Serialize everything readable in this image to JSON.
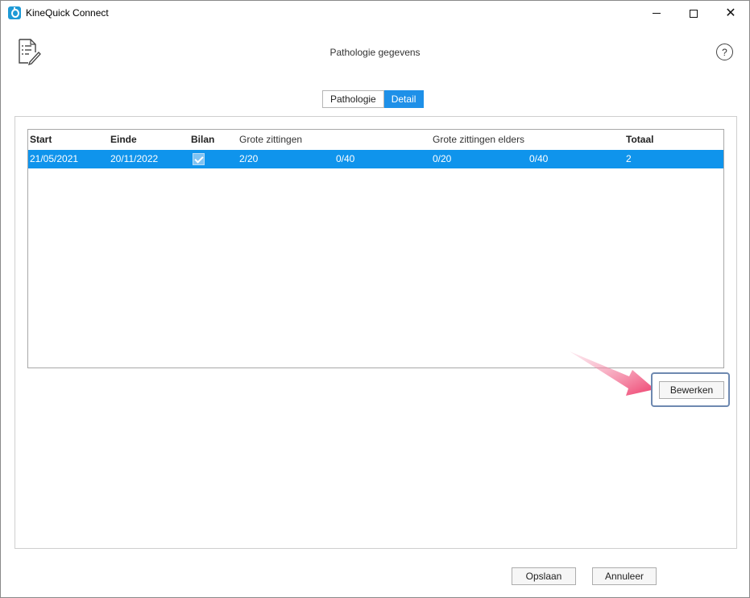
{
  "window": {
    "title": "KineQuick Connect"
  },
  "header": {
    "title": "Pathologie gegevens",
    "help_label": "?"
  },
  "tabs": [
    {
      "label": "Pathologie",
      "active": false
    },
    {
      "label": "Detail",
      "active": true
    }
  ],
  "grid": {
    "columns": {
      "start": "Start",
      "einde": "Einde",
      "bilan": "Bilan",
      "grote_zittingen": "Grote zittingen",
      "grote_zittingen_elders": "Grote zittingen elders",
      "totaal": "Totaal"
    },
    "rows": [
      {
        "start": "21/05/2021",
        "einde": "20/11/2022",
        "bilan_checked": true,
        "grote_zittingen": "2/20",
        "grote_zittingen_max": "0/40",
        "elders": "0/20",
        "elders_max": "0/40",
        "totaal": "2"
      }
    ]
  },
  "buttons": {
    "bewerken": "Bewerken",
    "opslaan": "Opslaan",
    "annuleer": "Annuleer"
  },
  "colors": {
    "accent": "#0f94ec",
    "tab_active": "#1e90e8",
    "annotation_arrow": "#ee3d6b"
  }
}
